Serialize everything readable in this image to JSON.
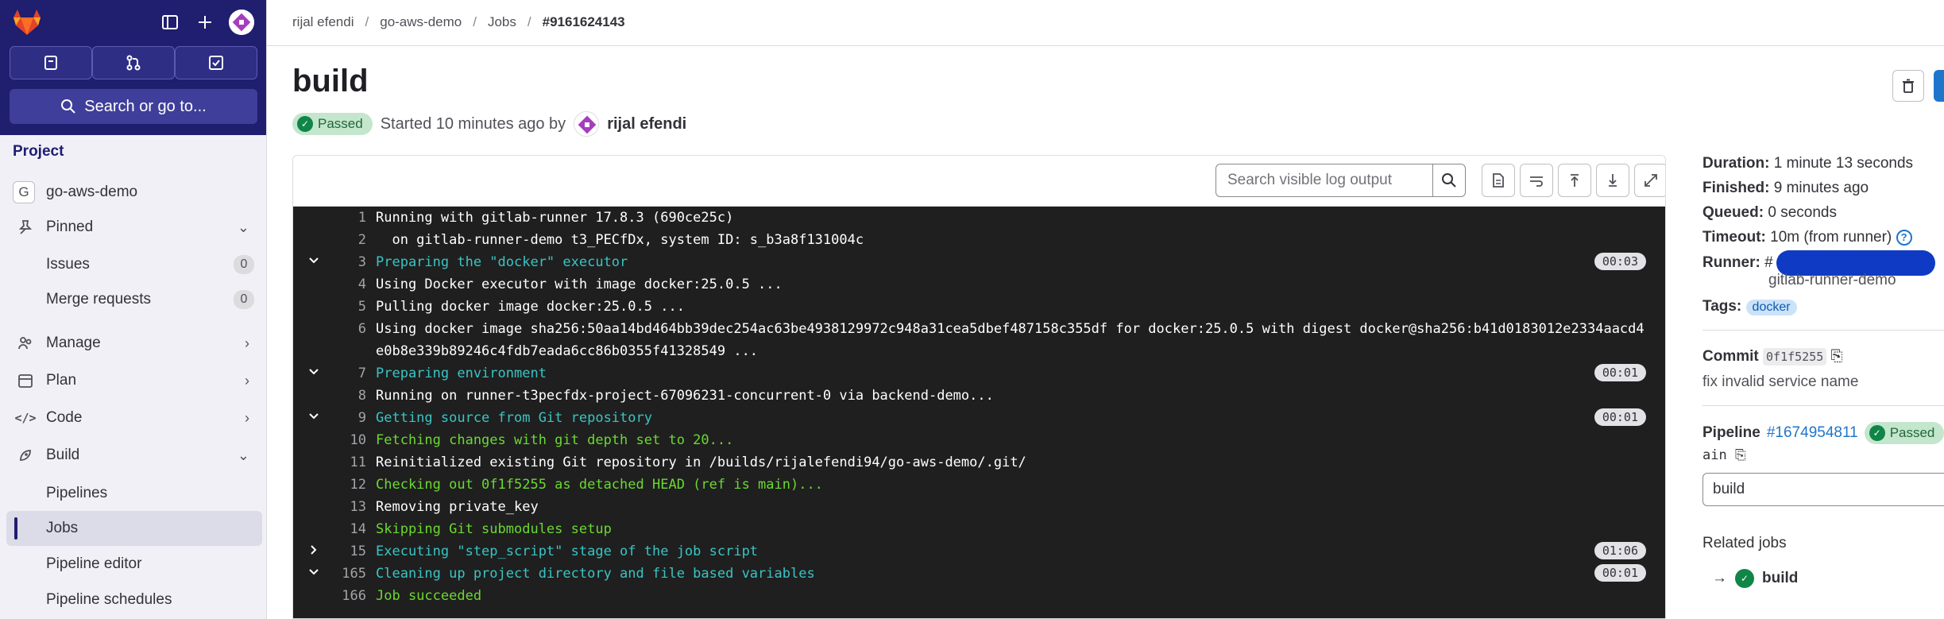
{
  "breadcrumb": [
    "rijal efendi",
    "go-aws-demo",
    "Jobs",
    "#9161624143"
  ],
  "sidebar": {
    "search_label": "Search or go to...",
    "section_title": "Project",
    "project_name": "go-aws-demo",
    "project_initial": "G",
    "items": [
      {
        "label": "Pinned"
      },
      {
        "label": "Issues",
        "count": "0"
      },
      {
        "label": "Merge requests",
        "count": "0"
      },
      {
        "label": "Manage"
      },
      {
        "label": "Plan"
      },
      {
        "label": "Code"
      },
      {
        "label": "Build"
      },
      {
        "label": "Pipelines"
      },
      {
        "label": "Jobs"
      },
      {
        "label": "Pipeline editor"
      },
      {
        "label": "Pipeline schedules"
      }
    ]
  },
  "job": {
    "title": "build",
    "status": "Passed",
    "started_text": "Started 10 minutes ago by",
    "user": "rijal efendi"
  },
  "log": {
    "search_placeholder": "Search visible log output",
    "lines": [
      {
        "num": "1",
        "text": "Running with gitlab-runner 17.8.3 (690ce25c)",
        "style": "",
        "toggle": "",
        "duration": ""
      },
      {
        "num": "2",
        "text": "  on gitlab-runner-demo t3_PECfDx, system ID: s_b3a8f131004c",
        "style": "",
        "toggle": "",
        "duration": ""
      },
      {
        "num": "3",
        "text": "Preparing the \"docker\" executor",
        "style": "cyan",
        "toggle": "v",
        "duration": "00:03"
      },
      {
        "num": "4",
        "text": "Using Docker executor with image docker:25.0.5 ...",
        "style": "",
        "toggle": "",
        "duration": ""
      },
      {
        "num": "5",
        "text": "Pulling docker image docker:25.0.5 ...",
        "style": "",
        "toggle": "",
        "duration": ""
      },
      {
        "num": "6",
        "text": "Using docker image sha256:50aa14bd464bb39dec254ac63be4938129972c948a31cea5dbef487158c355df for docker:25.0.5 with digest docker@sha256:b41d0183012e2334aacd4",
        "style": "",
        "toggle": "",
        "duration": ""
      },
      {
        "num": "",
        "text": "e0b8e339b89246c4fdb7eada6cc86b0355f41328549 ...",
        "style": "",
        "toggle": "",
        "duration": ""
      },
      {
        "num": "7",
        "text": "Preparing environment",
        "style": "cyan",
        "toggle": "v",
        "duration": "00:01"
      },
      {
        "num": "8",
        "text": "Running on runner-t3pecfdx-project-67096231-concurrent-0 via backend-demo...",
        "style": "",
        "toggle": "",
        "duration": ""
      },
      {
        "num": "9",
        "text": "Getting source from Git repository",
        "style": "cyan",
        "toggle": "v",
        "duration": "00:01"
      },
      {
        "num": "10",
        "text": "Fetching changes with git depth set to 20...",
        "style": "green",
        "toggle": "",
        "duration": ""
      },
      {
        "num": "11",
        "text": "Reinitialized existing Git repository in /builds/rijalefendi94/go-aws-demo/.git/",
        "style": "",
        "toggle": "",
        "duration": ""
      },
      {
        "num": "12",
        "text": "Checking out 0f1f5255 as detached HEAD (ref is main)...",
        "style": "green",
        "toggle": "",
        "duration": ""
      },
      {
        "num": "13",
        "text": "Removing private_key",
        "style": "",
        "toggle": "",
        "duration": ""
      },
      {
        "num": "14",
        "text": "Skipping Git submodules setup",
        "style": "green",
        "toggle": "",
        "duration": ""
      },
      {
        "num": "15",
        "text": "Executing \"step_script\" stage of the job script",
        "style": "cyan",
        "toggle": ">",
        "duration": "01:06"
      },
      {
        "num": "165",
        "text": "Cleaning up project directory and file based variables",
        "style": "cyan",
        "toggle": "v",
        "duration": "00:01"
      },
      {
        "num": "166",
        "text": "Job succeeded",
        "style": "green",
        "toggle": "",
        "duration": ""
      }
    ]
  },
  "details": {
    "duration_label": "Duration:",
    "duration": "1 minute 13 seconds",
    "finished_label": "Finished:",
    "finished": "9 minutes ago",
    "queued_label": "Queued:",
    "queued": "0 seconds",
    "timeout_label": "Timeout:",
    "timeout": "10m (from runner)",
    "runner_label": "Runner:",
    "runner_prefix": "#",
    "runner_name": "gitlab-runner-demo",
    "tags_label": "Tags:",
    "tag": "docker",
    "commit_label": "Commit",
    "commit_sha": "0f1f5255",
    "commit_message": "fix invalid service name",
    "pipeline_label": "Pipeline",
    "pipeline_id": "#1674954811",
    "pipeline_status": "Passed",
    "branch": "ain",
    "stage_select": "build",
    "related_jobs_label": "Related jobs",
    "related_job": "build"
  }
}
